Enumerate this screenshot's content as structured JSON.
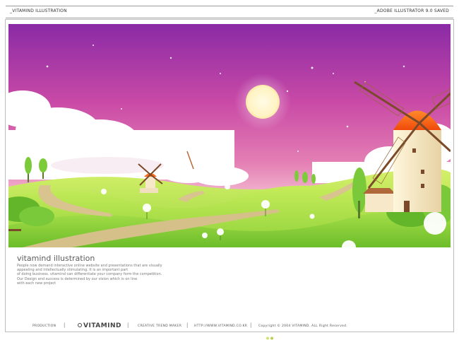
{
  "header": {
    "left_label": "_VITAMIND ILLUSTRATION",
    "right_label": "_ADOBE ILLUSTRATOR 9.0 SAVED"
  },
  "description": {
    "title": "vitamind illustration",
    "lines": [
      "People now demand interactive online website and presentations that are visually",
      "appealing and intellectually stimulating. It is an important part",
      "of doing business. vitamind can differentiate your company form the competition.",
      "Our Design and success is determined by our vision which is on line",
      "with each new project"
    ]
  },
  "footer": {
    "production": "PRODUCTION",
    "brand": "VITAMIND",
    "tagline": "CREATIVE TREND MAKER",
    "url": "HTTP://WWW.VITAMIND.CO.KR",
    "copyright": "Copyright © 2004 VITAMIND. ALL Right Reserved."
  },
  "colors": {
    "sky_top": "#8a2aa6",
    "sky_mid": "#d0509c",
    "sky_horizon": "#f7c9d8",
    "grass_light": "#b9e64a",
    "grass_dark": "#6fbf2a",
    "path": "#d6c28a",
    "windmill_roof": "#ff6a1a",
    "windmill_tower": "#f6e8c8"
  }
}
